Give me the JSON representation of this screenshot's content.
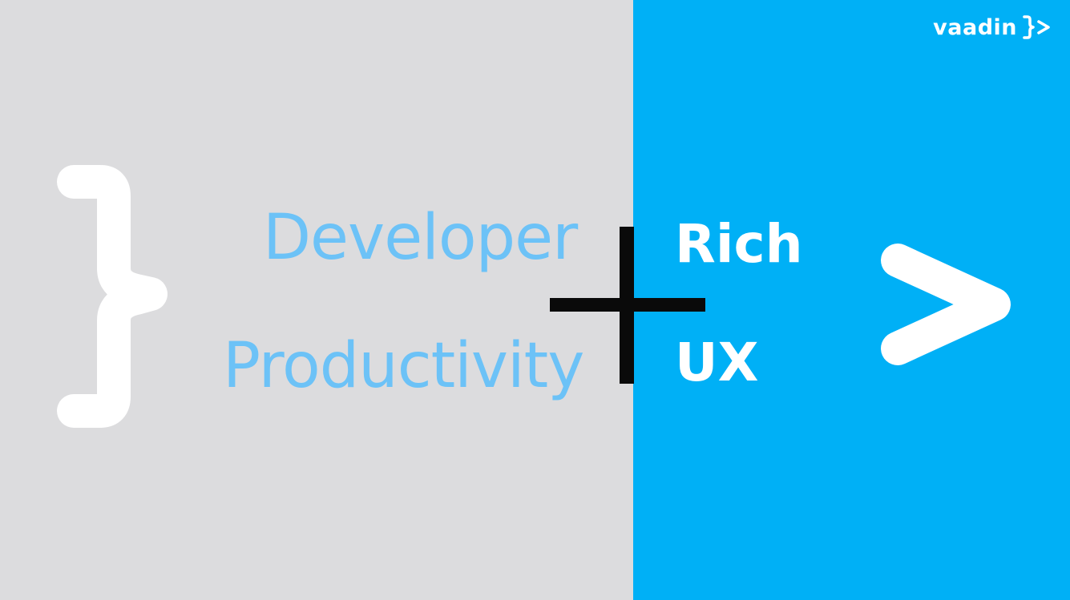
{
  "slide": {
    "left_words": [
      "Developer",
      "Productivity"
    ],
    "right_words": [
      "Rich",
      "UX"
    ],
    "operator": "+"
  },
  "logo": {
    "text": "vaadin",
    "mark_icon": "vaadin-brace-chevron-icon"
  },
  "decor": {
    "left_symbol": "brace-icon",
    "right_symbol": "chevron-right-icon"
  },
  "colors": {
    "left_panel": "#dcdcde",
    "right_panel": "#00b0f6",
    "left_text": "#6cc2f7",
    "right_text": "#ffffff",
    "operator": "#0a0a0a"
  }
}
